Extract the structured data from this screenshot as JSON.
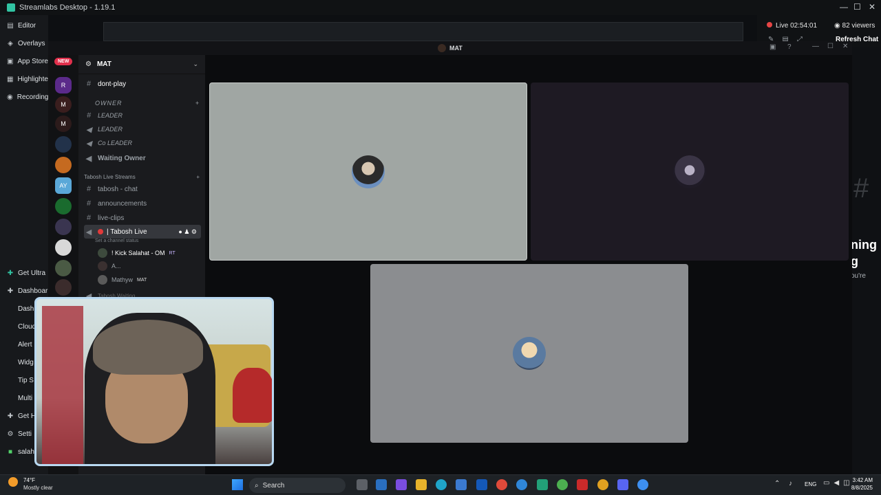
{
  "app": {
    "title": "Streamlabs Desktop - 1.19.1"
  },
  "sidebar": {
    "editor": "Editor",
    "items_top": [
      "Overlays",
      "App Store",
      "Highlighter",
      "Recordings"
    ],
    "items_bottom": [
      "Get Ultra",
      "Dashboard",
      "Dashboard",
      "Cloudbot",
      "Alert Box",
      "Widgets",
      "Tip Settings",
      "Multistream",
      "Get Help",
      "Settings"
    ],
    "visible_bottom_labels": [
      "Get Ultra",
      "Dashboar",
      "Dash",
      "Cloud",
      "Alert",
      "Widg",
      "Tip S",
      "Multi",
      "Get H",
      "Setti"
    ],
    "user": "salah"
  },
  "status": {
    "live": "Live 02:54:01",
    "viewers": "82 viewers",
    "refresh_chat": "Refresh Chat"
  },
  "discord": {
    "window_title": "MAT",
    "server_name": "MAT",
    "new_badge": "NEW",
    "channels": [
      {
        "icon": "#",
        "label": "dont-play"
      },
      {
        "icon": "",
        "label": "OWNER"
      },
      {
        "icon": "#",
        "label": "LEADER"
      },
      {
        "icon": "speaker",
        "label": "LEADER"
      },
      {
        "icon": "speaker",
        "label": "Co LEADER"
      },
      {
        "icon": "speaker",
        "label": "Waiting Owner"
      }
    ],
    "category": "Tabosh Live Streams",
    "stream_channels": [
      {
        "icon": "#",
        "label": "tabosh - chat"
      },
      {
        "icon": "#",
        "label": "announcements"
      },
      {
        "icon": "#",
        "label": "live-clips"
      }
    ],
    "active_voice": "| Tabosh Live",
    "voice_status": "Set a channel status",
    "voice_users": [
      {
        "name": "! Kick Salahat - OM",
        "tag": "RT"
      },
      {
        "name": "A...",
        "tag": ""
      },
      {
        "name": "Mathyw",
        "tag": "MAT"
      }
    ],
    "partial_channel": "Tabosh Waiting"
  },
  "side_text": {
    "line1": "ning",
    "line2": "g",
    "line3": "ou're"
  },
  "taskbar": {
    "weather_temp": "74°F",
    "weather_desc": "Mostly clear",
    "search": "Search",
    "lang": "ENG",
    "time": "3:42 AM",
    "date": "8/8/2025"
  }
}
